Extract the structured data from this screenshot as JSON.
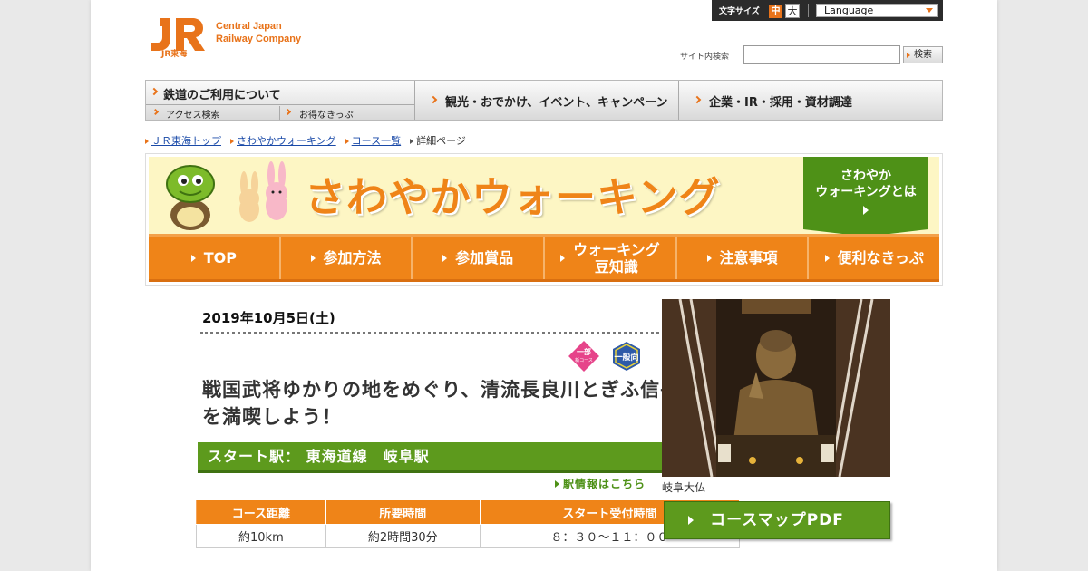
{
  "header": {
    "logo_mark": "JR",
    "logo_sub": "JR東海",
    "company_line1": "Central Japan",
    "company_line2": "Railway Company",
    "font_size_label": "文字サイズ",
    "font_size_medium": "中",
    "font_size_large": "大",
    "language_label": "Language",
    "search_label": "サイト内検索",
    "search_value": "",
    "search_button": "検索"
  },
  "global_nav": {
    "railway_use": "鉄道のご利用について",
    "access_search": "アクセス検索",
    "value_tickets": "お得なきっぷ",
    "tourism": "観光・おでかけ、イベント、キャンペーン",
    "corporate": "企業・IR・採用・資材調達"
  },
  "breadcrumb": {
    "top": "ＪＲ東海トップ",
    "walking": "さわやかウォーキング",
    "course_list": "コース一覧",
    "current": "詳細ページ"
  },
  "banner": {
    "title": "さわやかウォーキング",
    "about_line1": "さわやか",
    "about_line2": "ウォーキングとは"
  },
  "sub_nav": [
    {
      "label1": "TOP",
      "label2": ""
    },
    {
      "label1": "参加方法",
      "label2": ""
    },
    {
      "label1": "参加賞品",
      "label2": ""
    },
    {
      "label1": "ウォーキング",
      "label2": "豆知識"
    },
    {
      "label1": "注意事項",
      "label2": ""
    },
    {
      "label1": "便利なきっぷ",
      "label2": ""
    }
  ],
  "event": {
    "date": "2019年10月5日(土)",
    "badge_partial_line1": "一部",
    "badge_partial_line2": "新コース",
    "badge_general": "一般向",
    "title": "戦国武将ゆかりの地をめぐり、清流長良川とぎふ信長まつりを満喫しよう！",
    "start_station": "スタート駅： 東海道線　岐阜駅",
    "station_info_link": "駅情報はこちら",
    "table_headers": [
      "コース距離",
      "所要時間",
      "スタート受付時間"
    ],
    "table_values": [
      "約10km",
      "約2時間30分",
      "８：３０～１１：００"
    ],
    "photo_caption": "岐阜大仏",
    "course_map_button": "コースマップPDF"
  },
  "colors": {
    "accent_orange": "#ef8418",
    "accent_green": "#5d9a1d",
    "banner_yellow": "#fdf6c4",
    "link_blue": "#1a4aa8"
  }
}
